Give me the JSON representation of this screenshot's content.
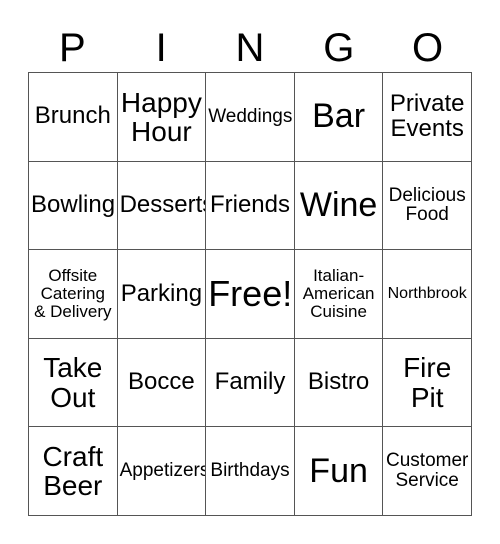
{
  "card": {
    "header": {
      "letters": [
        "P",
        "I",
        "N",
        "G",
        "O"
      ]
    },
    "grid": {
      "columns": 5,
      "rows": 5,
      "colors": {
        "border": "#555555",
        "background": "#ffffff",
        "text": "#000000"
      },
      "cells": [
        {
          "text": "Brunch",
          "size": "fs-md"
        },
        {
          "text": "Happy\nHour",
          "size": "fs-ml"
        },
        {
          "text": "Weddings",
          "size": "fs-sm"
        },
        {
          "text": "Bar",
          "size": "fs-lg"
        },
        {
          "text": "Private\nEvents",
          "size": "fs-md"
        },
        {
          "text": "Bowling",
          "size": "fs-md"
        },
        {
          "text": "Desserts",
          "size": "fs-md"
        },
        {
          "text": "Friends",
          "size": "fs-md"
        },
        {
          "text": "Wine",
          "size": "fs-lg"
        },
        {
          "text": "Delicious\nFood",
          "size": "fs-sm"
        },
        {
          "text": "Offsite\nCatering\n& Delivery",
          "size": "fs-xs"
        },
        {
          "text": "Parking",
          "size": "fs-md"
        },
        {
          "text": "Free!",
          "size": "fs-xl"
        },
        {
          "text": "Italian-\nAmerican\nCuisine",
          "size": "fs-xs"
        },
        {
          "text": "Northbrook",
          "size": "fs-xxs"
        },
        {
          "text": "Take\nOut",
          "size": "fs-ml"
        },
        {
          "text": "Bocce",
          "size": "fs-md"
        },
        {
          "text": "Family",
          "size": "fs-md"
        },
        {
          "text": "Bistro",
          "size": "fs-md"
        },
        {
          "text": "Fire\nPit",
          "size": "fs-ml"
        },
        {
          "text": "Craft\nBeer",
          "size": "fs-ml"
        },
        {
          "text": "Appetizers",
          "size": "fs-sm"
        },
        {
          "text": "Birthdays",
          "size": "fs-sm"
        },
        {
          "text": "Fun",
          "size": "fs-lg"
        },
        {
          "text": "Customer\nService",
          "size": "fs-sm"
        }
      ]
    }
  }
}
